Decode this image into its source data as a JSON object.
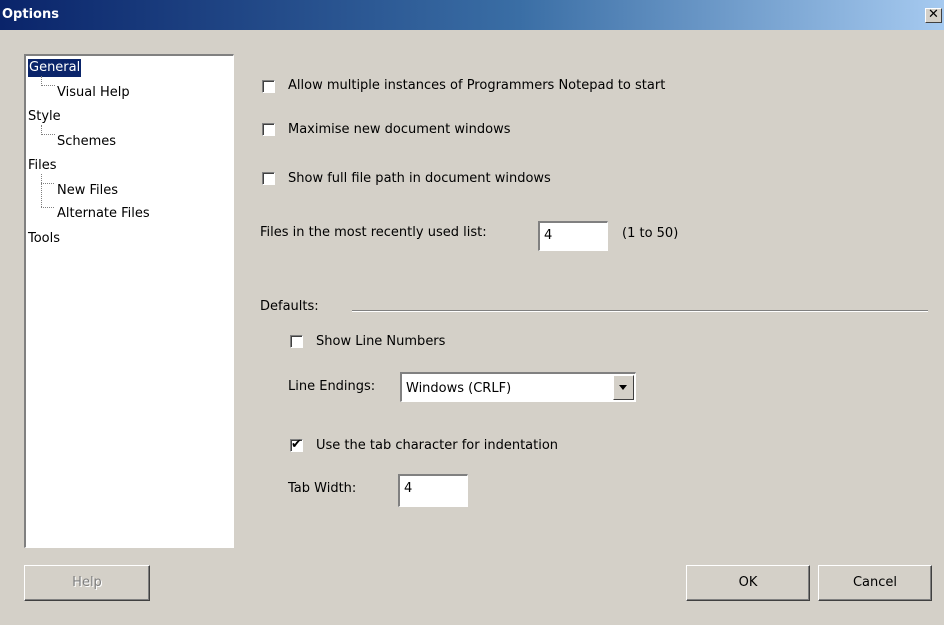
{
  "window": {
    "title": "Options",
    "close_glyph": "✕",
    "close_icon": "close-icon"
  },
  "tree": {
    "items": [
      {
        "label": "General",
        "level": 0,
        "selected": true
      },
      {
        "label": "Visual Help",
        "level": 1
      },
      {
        "label": "Style",
        "level": 0
      },
      {
        "label": "Schemes",
        "level": 1
      },
      {
        "label": "Files",
        "level": 0
      },
      {
        "label": "New Files",
        "level": 1
      },
      {
        "label": "Alternate Files",
        "level": 1
      },
      {
        "label": "Tools",
        "level": 0
      }
    ]
  },
  "general": {
    "allow_multiple": {
      "label": "Allow multiple instances of Programmers Notepad to start",
      "checked": false
    },
    "maximise": {
      "label": "Maximise new document windows",
      "checked": false
    },
    "full_path": {
      "label": "Show full file path in document windows",
      "checked": false
    },
    "mru": {
      "label": "Files in the most recently used list:",
      "value": "4",
      "range": "(1 to 50)"
    }
  },
  "defaults": {
    "label": "Defaults:",
    "line_numbers": {
      "label": "Show Line Numbers",
      "checked": false
    },
    "line_endings": {
      "label": "Line Endings:",
      "value": "Windows (CRLF)"
    },
    "use_tabs": {
      "label": "Use the tab character for indentation",
      "checked": true,
      "check_glyph": "✔"
    },
    "tab_width": {
      "label": "Tab Width:",
      "value": "4"
    }
  },
  "buttons": {
    "help": "Help",
    "ok": "OK",
    "cancel": "Cancel"
  },
  "colors": {
    "face": "#d4d0c8",
    "title_start": "#0a246a",
    "title_end": "#a6caf0",
    "selection": "#0a246a"
  }
}
